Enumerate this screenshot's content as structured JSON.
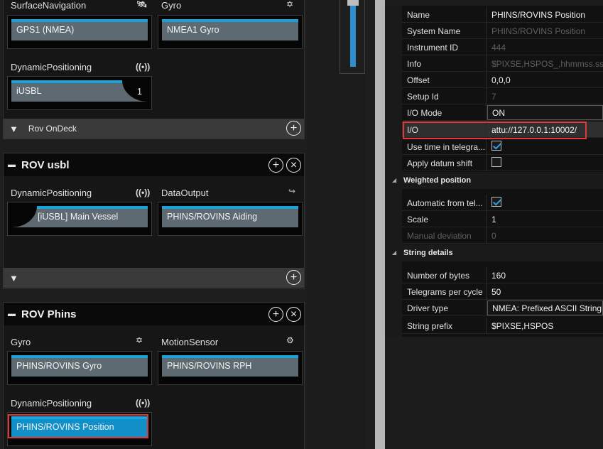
{
  "left_top": {
    "surface_nav": {
      "label": "SurfaceNavigation",
      "device": "GPS1 (NMEA)"
    },
    "gyro": {
      "label": "Gyro",
      "device": "NMEA1 Gyro"
    },
    "dp": {
      "label": "DynamicPositioning",
      "device": "iUSBL",
      "count": "1"
    },
    "footer": "Rov OnDeck"
  },
  "rov_usbl": {
    "title": "ROV usbl",
    "dp": {
      "label": "DynamicPositioning",
      "device": "[iUSBL] Main Vessel"
    },
    "data_output": {
      "label": "DataOutput",
      "device": "PHINS/ROVINS Aiding"
    }
  },
  "rov_phins": {
    "title": "ROV Phins",
    "gyro": {
      "label": "Gyro",
      "device": "PHINS/ROVINS Gyro"
    },
    "motion": {
      "label": "MotionSensor",
      "device": "PHINS/ROVINS RPH"
    },
    "dp": {
      "label": "DynamicPositioning",
      "device": "PHINS/ROVINS Position"
    }
  },
  "properties": {
    "rows": [
      {
        "k": "Name",
        "v": "PHINS/ROVINS Position"
      },
      {
        "k": "System Name",
        "v": "PHINS/ROVINS Position"
      },
      {
        "k": "Instrument ID",
        "v": "444"
      },
      {
        "k": "Info",
        "v": "$PIXSE,HSPOS_,hhmmss.ss,llm"
      },
      {
        "k": "Offset",
        "v": "0,0,0"
      },
      {
        "k": "Setup Id",
        "v": "7"
      },
      {
        "k": "I/O Mode",
        "v": "ON"
      },
      {
        "k": "I/O",
        "v": "attu://127.0.0.1:10002/"
      },
      {
        "k": "Use time in telegra...",
        "v": ""
      },
      {
        "k": "Apply datum shift",
        "v": ""
      }
    ],
    "weighted_section": "Weighted position",
    "weighted_rows": [
      {
        "k": "Automatic from tel...",
        "v": ""
      },
      {
        "k": "Scale",
        "v": "1"
      },
      {
        "k": "Manual deviation",
        "v": "0"
      }
    ],
    "string_section": "String details",
    "string_rows": [
      {
        "k": "Number of bytes",
        "v": "160"
      },
      {
        "k": "Telegrams per cycle",
        "v": "50"
      },
      {
        "k": "Driver type",
        "v": "NMEA:   Prefixed ASCII String"
      },
      {
        "k": "String prefix",
        "v": "$PIXSE,HSPOS"
      }
    ]
  },
  "colors": {
    "accent": "#1aa3d9",
    "highlight": "#e0393b"
  }
}
